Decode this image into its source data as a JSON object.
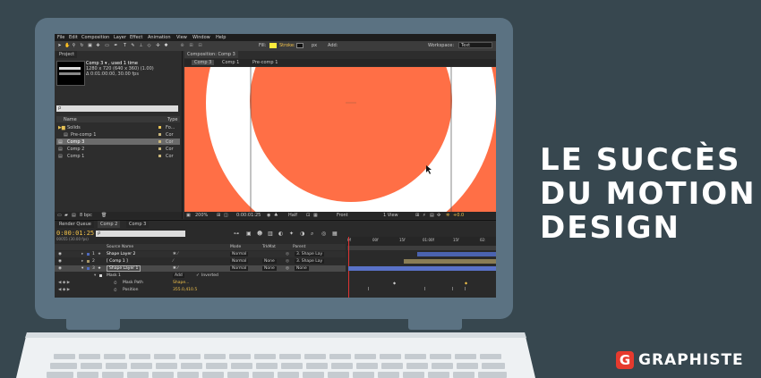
{
  "headline": {
    "line1": "LE SUCCÈS",
    "line2": "DU MOTION",
    "line3": "DESIGN"
  },
  "brand": {
    "badge": "G",
    "name": "GRAPHISTE",
    "badge_color": "#e63a2e"
  },
  "colors": {
    "background": "#37474f",
    "laptop": "#5b7282",
    "viewer": "#ff6f46"
  },
  "app": {
    "menu": [
      "File",
      "Edit",
      "Composition",
      "Layer",
      "Effect",
      "Animation",
      "View",
      "Window",
      "Help"
    ],
    "fill_label": "Fill:",
    "stroke_label": "Stroke:",
    "stroke_px": "px",
    "add_label": "Add:",
    "workspace_label": "Workspace:",
    "workspace_value": "Text",
    "project": {
      "tab": "Project",
      "item_name": "Comp 3 ▾ , used 1 time",
      "item_size": "1280 x 720 (640 x 360) (1.00)",
      "item_duration": "Δ 0:01:00:00, 30.00 fps",
      "search_placeholder": "ρ",
      "col_name": "Name",
      "col_type": "Type",
      "items": [
        {
          "name": "Solids",
          "type": "Fo..."
        },
        {
          "name": "Pre-comp 1",
          "type": "Cor"
        },
        {
          "name": "Comp 3",
          "type": "Cor"
        },
        {
          "name": "Comp 2",
          "type": "Cor"
        },
        {
          "name": "Comp 1",
          "type": "Cor"
        }
      ],
      "bpc": "8 bpc"
    },
    "comp": {
      "tab": "Composition: Comp 3",
      "breadcrumbs": [
        "Comp 3",
        "Comp 1",
        "Pre-comp 1"
      ],
      "zoom": "200%",
      "timecode": "0:00:01:25",
      "resolution": "Half",
      "view": "Front",
      "views": "1 View",
      "exposure": "+0.0"
    },
    "timeline": {
      "tabs": [
        "Render Queue",
        "Comp 2",
        "Comp 3"
      ],
      "timecode": "0:00:01:25",
      "fps": "00055 (30.00 fps)",
      "col_source": "Source Name",
      "col_mode": "Mode",
      "col_trkmat": "TrkMat",
      "col_parent": "Parent",
      "ruler": [
        "0f",
        "00f",
        "15f",
        "01:00f",
        "15f",
        "02:"
      ],
      "layers": [
        {
          "num": "1",
          "name": "Shape Layer 2",
          "mode": "Normal",
          "trkmat": "",
          "parent": "3. Shape Lay"
        },
        {
          "num": "2",
          "name": "[ Comp 1 ]",
          "mode": "Normal",
          "trkmat": "None",
          "parent": "3. Shape Lay"
        },
        {
          "num": "3",
          "name": "Shape Layer 1",
          "mode": "Normal",
          "trkmat": "None",
          "parent": "None"
        }
      ],
      "mask_name": "Mask 1",
      "mask_mode": "Add",
      "mask_inverted": "Inverted",
      "mask_path_label": "Mask Path",
      "mask_path_value": "Shape...",
      "position_label": "Position",
      "position_value": "355.0,410.5"
    }
  }
}
